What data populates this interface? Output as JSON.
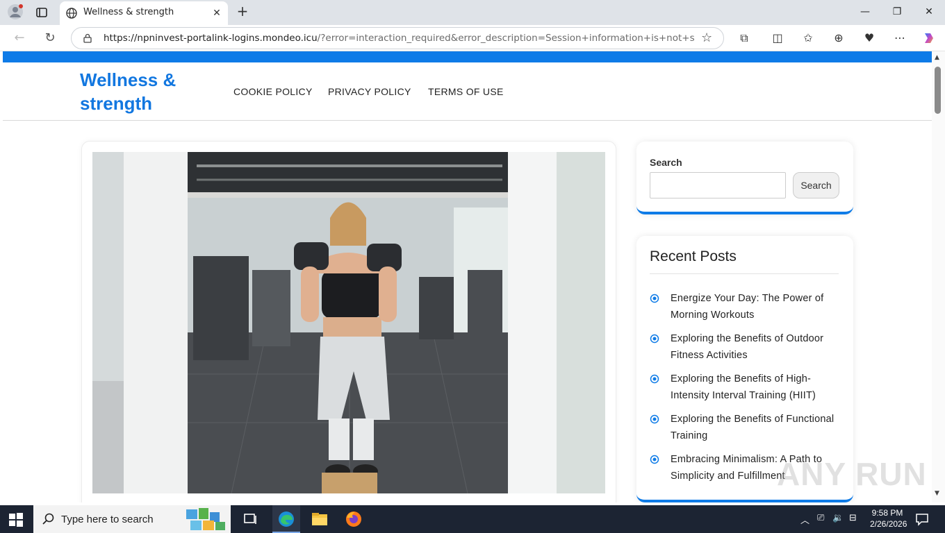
{
  "browser": {
    "tab_title": "Wellness & strength",
    "url_main": "https://npninvest-portalink-logins.mondeo.icu",
    "url_rest": "/?error=interaction_required&error_description=Session+information+is+not+sufficient..."
  },
  "site": {
    "brand": "Wellness & strength",
    "menu": [
      "COOKIE POLICY",
      "PRIVACY POLICY",
      "TERMS OF USE"
    ],
    "accent_color": "#0e7be7"
  },
  "search_widget": {
    "label": "Search",
    "value": "",
    "button": "Search"
  },
  "recent_posts": {
    "heading": "Recent Posts",
    "items": [
      "Energize Your Day: The Power of Morning Workouts",
      "Exploring the Benefits of Outdoor Fitness Activities",
      "Exploring the Benefits of High-Intensity Interval Training (HIIT)",
      "Exploring the Benefits of Functional Training",
      "Embracing Minimalism: A Path to Simplicity and Fulfillment"
    ]
  },
  "taskbar": {
    "search_placeholder": "Type here to search",
    "time": "9:58 PM",
    "date": "2/26/2026"
  },
  "watermark": "ANY RUN"
}
